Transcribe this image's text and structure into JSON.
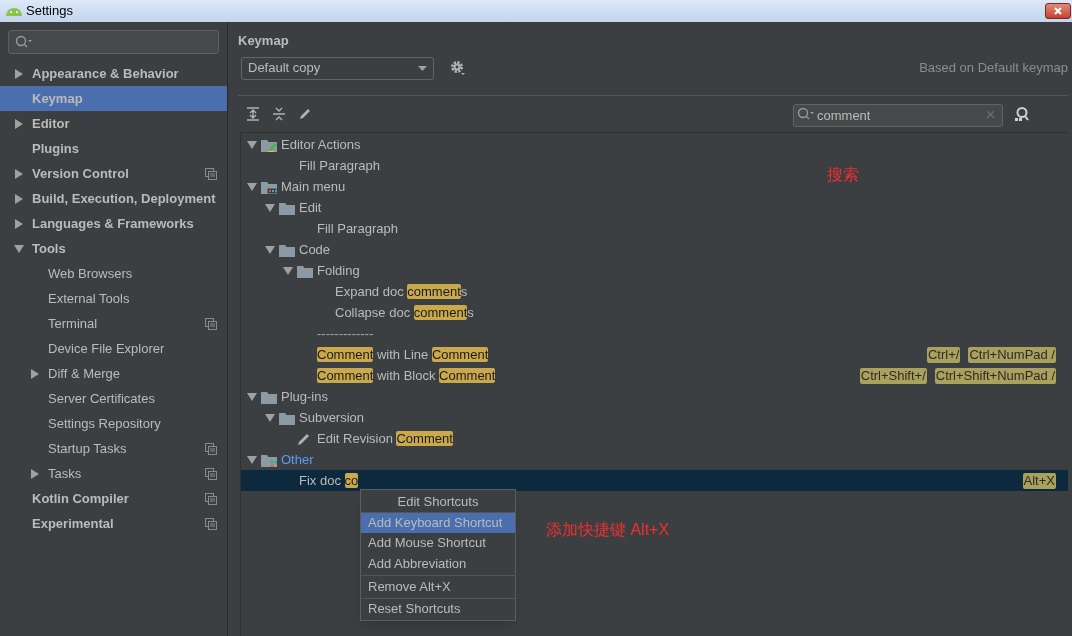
{
  "window": {
    "title": "Settings"
  },
  "sidebar": {
    "items": [
      {
        "label": "Appearance & Behavior",
        "kind": "group",
        "expanded": false,
        "selected": false,
        "project_scoped": false
      },
      {
        "label": "Keymap",
        "kind": "leaf",
        "selected": true,
        "project_scoped": false
      },
      {
        "label": "Editor",
        "kind": "group",
        "expanded": false,
        "selected": false,
        "project_scoped": false
      },
      {
        "label": "Plugins",
        "kind": "leaf",
        "selected": false,
        "project_scoped": false
      },
      {
        "label": "Version Control",
        "kind": "group",
        "expanded": false,
        "selected": false,
        "project_scoped": true
      },
      {
        "label": "Build, Execution, Deployment",
        "kind": "group",
        "expanded": false,
        "selected": false,
        "project_scoped": false
      },
      {
        "label": "Languages & Frameworks",
        "kind": "group",
        "expanded": false,
        "selected": false,
        "project_scoped": false
      },
      {
        "label": "Tools",
        "kind": "group",
        "expanded": true,
        "selected": false,
        "project_scoped": false,
        "children": [
          {
            "label": "Web Browsers",
            "kind": "leaf",
            "selected": false,
            "project_scoped": false
          },
          {
            "label": "External Tools",
            "kind": "leaf",
            "selected": false,
            "project_scoped": false
          },
          {
            "label": "Terminal",
            "kind": "leaf",
            "selected": false,
            "project_scoped": true
          },
          {
            "label": "Device File Explorer",
            "kind": "leaf",
            "selected": false,
            "project_scoped": false
          },
          {
            "label": "Diff & Merge",
            "kind": "group",
            "expanded": false,
            "selected": false,
            "project_scoped": false
          },
          {
            "label": "Server Certificates",
            "kind": "leaf",
            "selected": false,
            "project_scoped": false
          },
          {
            "label": "Settings Repository",
            "kind": "leaf",
            "selected": false,
            "project_scoped": false
          },
          {
            "label": "Startup Tasks",
            "kind": "leaf",
            "selected": false,
            "project_scoped": true
          },
          {
            "label": "Tasks",
            "kind": "group",
            "expanded": false,
            "selected": false,
            "project_scoped": true
          }
        ]
      },
      {
        "label": "Kotlin Compiler",
        "kind": "leaf",
        "selected": false,
        "project_scoped": true
      },
      {
        "label": "Experimental",
        "kind": "leaf",
        "selected": false,
        "project_scoped": true
      }
    ]
  },
  "keymap": {
    "title": "Keymap",
    "scheme": "Default copy",
    "based_on": "Based on Default keymap",
    "search": {
      "value": "comment"
    },
    "tree": [
      {
        "kind": "editor_folder",
        "expanded": true,
        "modified": false,
        "selected": false,
        "parts": [
          {
            "text": "Editor Actions",
            "match": false
          }
        ],
        "children": [
          {
            "kind": "action",
            "selected": false,
            "parts": [
              {
                "text": "Fill Paragraph",
                "match": false
              }
            ]
          }
        ]
      },
      {
        "kind": "menu_folder",
        "expanded": true,
        "modified": false,
        "selected": false,
        "parts": [
          {
            "text": "Main menu",
            "match": false
          }
        ],
        "children": [
          {
            "kind": "folder",
            "expanded": true,
            "modified": false,
            "selected": false,
            "parts": [
              {
                "text": "Edit",
                "match": false
              }
            ],
            "children": [
              {
                "kind": "action",
                "selected": false,
                "parts": [
                  {
                    "text": "Fill Paragraph",
                    "match": false
                  }
                ]
              }
            ]
          },
          {
            "kind": "folder",
            "expanded": true,
            "modified": false,
            "selected": false,
            "parts": [
              {
                "text": "Code",
                "match": false
              }
            ],
            "children": [
              {
                "kind": "folder",
                "expanded": true,
                "modified": false,
                "selected": false,
                "parts": [
                  {
                    "text": "Folding",
                    "match": false
                  }
                ],
                "children": [
                  {
                    "kind": "action",
                    "selected": false,
                    "parts": [
                      {
                        "text": "Expand doc ",
                        "match": false
                      },
                      {
                        "text": "comment",
                        "match": true
                      },
                      {
                        "text": "s",
                        "match": false
                      }
                    ]
                  },
                  {
                    "kind": "action",
                    "selected": false,
                    "parts": [
                      {
                        "text": "Collapse doc ",
                        "match": false
                      },
                      {
                        "text": "comment",
                        "match": true
                      },
                      {
                        "text": "s",
                        "match": false
                      }
                    ]
                  }
                ]
              },
              {
                "kind": "separator",
                "selected": false,
                "parts": [
                  {
                    "text": "-------------",
                    "match": false
                  }
                ]
              },
              {
                "kind": "action",
                "selected": false,
                "parts": [
                  {
                    "text": "Comment",
                    "match": true
                  },
                  {
                    "text": " with Line ",
                    "match": false
                  },
                  {
                    "text": "Comment",
                    "match": true
                  }
                ],
                "shortcuts": [
                  "Ctrl+/",
                  "Ctrl+NumPad /"
                ]
              },
              {
                "kind": "action",
                "selected": false,
                "parts": [
                  {
                    "text": "Comment",
                    "match": true
                  },
                  {
                    "text": " with Block ",
                    "match": false
                  },
                  {
                    "text": "Comment",
                    "match": true
                  }
                ],
                "shortcuts": [
                  "Ctrl+Shift+/",
                  "Ctrl+Shift+NumPad /"
                ]
              }
            ]
          }
        ]
      },
      {
        "kind": "folder",
        "expanded": true,
        "modified": false,
        "selected": false,
        "parts": [
          {
            "text": "Plug-ins",
            "match": false
          }
        ],
        "children": [
          {
            "kind": "folder",
            "expanded": true,
            "modified": false,
            "selected": false,
            "parts": [
              {
                "text": "Subversion",
                "match": false
              }
            ],
            "children": [
              {
                "kind": "edit_action",
                "selected": false,
                "parts": [
                  {
                    "text": "Edit Revision ",
                    "match": false
                  },
                  {
                    "text": "Comment",
                    "match": true
                  }
                ]
              }
            ]
          }
        ]
      },
      {
        "kind": "other_folder",
        "expanded": true,
        "modified": true,
        "selected": false,
        "parts": [
          {
            "text": "Other",
            "match": false
          }
        ],
        "children": [
          {
            "kind": "action",
            "selected": true,
            "parts": [
              {
                "text": "Fix doc ",
                "match": false
              },
              {
                "text": "co",
                "match": true
              }
            ],
            "shortcuts": [
              "Alt+X"
            ]
          }
        ]
      }
    ]
  },
  "context_menu": {
    "title": "Edit Shortcuts",
    "items": [
      {
        "label": "Add Keyboard Shortcut",
        "selected": true,
        "divider_after": false
      },
      {
        "label": "Add Mouse Shortcut",
        "selected": false,
        "divider_after": false
      },
      {
        "label": "Add Abbreviation",
        "selected": false,
        "divider_after": true
      },
      {
        "label": "Remove Alt+X",
        "selected": false,
        "divider_after": true
      },
      {
        "label": "Reset Shortcuts",
        "selected": false,
        "divider_after": false
      }
    ]
  },
  "annotations": [
    {
      "text": "搜索"
    },
    {
      "text": "添加快捷键 Alt+X"
    }
  ]
}
